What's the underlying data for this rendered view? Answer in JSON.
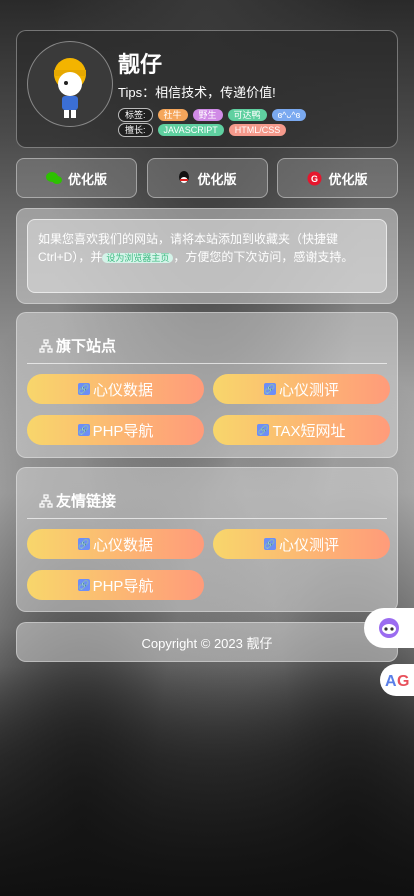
{
  "profile": {
    "name": "靓仔",
    "tips": "Tips：相信技术，传递价值!",
    "tags_label": "标签:",
    "tags": [
      {
        "text": "社牛",
        "color": "#f5a65b"
      },
      {
        "text": "野生",
        "color": "#d08be6"
      },
      {
        "text": "可达鸭",
        "color": "#5fd0a0"
      },
      {
        "text": "ɞ^ᴗ^ɞ",
        "color": "#7aa9f0"
      }
    ],
    "skills_label": "擅长:",
    "skills": [
      {
        "text": "JAVASCRIPT",
        "color": "#5fd0a0"
      },
      {
        "text": "HTML/CSS",
        "color": "#f59a8c"
      }
    ]
  },
  "buttons": [
    {
      "label": "优化版",
      "icon": "wechat-icon",
      "color": "#2dc100"
    },
    {
      "label": "优化版",
      "icon": "qq-icon",
      "color": "#000000"
    },
    {
      "label": "优化版",
      "icon": "weibo-icon",
      "color": "#e6162d"
    }
  ],
  "notice": {
    "text_before": "如果您喜欢我们的网站，请将本站添加到收藏夹（快捷键Ctrl+D），并",
    "highlight": "设为浏览器主页",
    "text_after": "，方便您的下次访问，感谢支持。"
  },
  "sites": {
    "title": "旗下站点",
    "items": [
      "心仪数据",
      "心仪测评",
      "PHP导航",
      "TAX短网址"
    ]
  },
  "friends": {
    "title": "友情链接",
    "items": [
      "心仪数据",
      "心仪测评",
      "PHP导航"
    ]
  },
  "footer": {
    "text": "Copyright © 2023 靓仔"
  }
}
